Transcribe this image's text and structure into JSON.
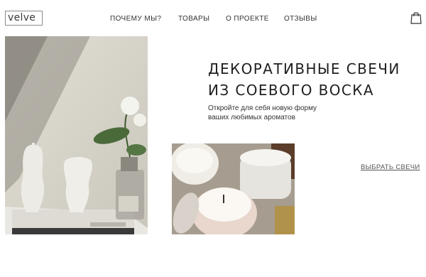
{
  "header": {
    "logo": "velve",
    "nav": [
      {
        "label": "ПОЧЕМУ МЫ?"
      },
      {
        "label": "ТОВАРЫ"
      },
      {
        "label": "О ПРОЕКТЕ"
      },
      {
        "label": "ОТЗЫВЫ"
      }
    ],
    "cart_icon": "shopping-bag-icon"
  },
  "hero": {
    "title_line1": "ДЕКОРАТИВНЫЕ СВЕЧИ",
    "title_line2": "ИЗ СОЕВОГО ВОСКА",
    "subtitle_line1": "Откройте для себя новую форму",
    "subtitle_line2": "ваших любимых ароматов",
    "cta_label": "ВЫБРАТЬ СВЕЧИ"
  },
  "colors": {
    "text": "#1f1f1f",
    "background": "#ffffff"
  }
}
